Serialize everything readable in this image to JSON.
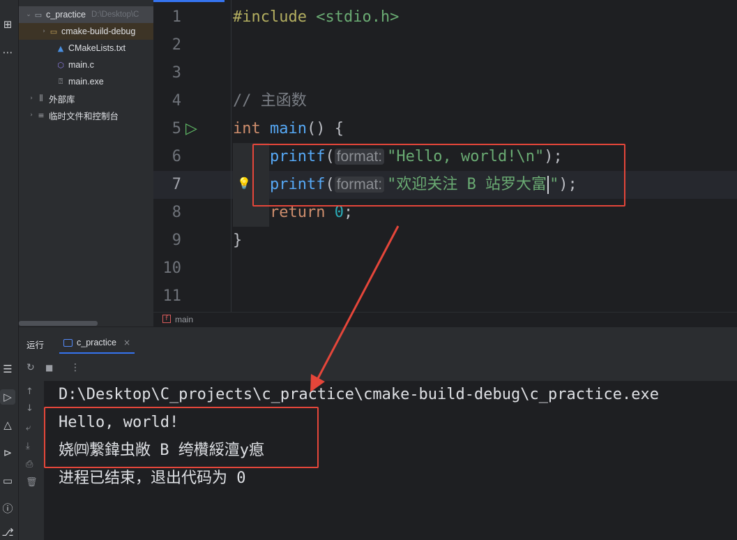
{
  "project_tree": [
    {
      "label": "c_practice",
      "hint": "D:\\Desktop\\C",
      "arrow": "⌄",
      "icon": "folder-icon",
      "depth": 1,
      "selected": true
    },
    {
      "label": "cmake-build-debug",
      "arrow": "›",
      "icon": "folder-icon",
      "depth": 2,
      "selected": false
    },
    {
      "label": "CMakeLists.txt",
      "arrow": "",
      "icon": "cmake-icon",
      "depth": 2,
      "selected": false
    },
    {
      "label": "main.c",
      "arrow": "",
      "icon": "c-file-icon",
      "depth": 2,
      "selected": false
    },
    {
      "label": "main.exe",
      "arrow": "",
      "icon": "unknown-file-icon",
      "depth": 2,
      "selected": false
    },
    {
      "label": "外部库",
      "arrow": "›",
      "icon": "library-icon",
      "depth": 1,
      "selected": false
    },
    {
      "label": "临时文件和控制台",
      "arrow": "›",
      "icon": "scratch-icon",
      "depth": 1,
      "selected": false
    }
  ],
  "editor": {
    "line_numbers": [
      "1",
      "2",
      "3",
      "4",
      "5",
      "6",
      "7",
      "8",
      "9",
      "10",
      "11"
    ],
    "current_line": "7",
    "code": {
      "l1_macro": "#include",
      "l1_header": "<stdio.h>",
      "l4_comment": "// 主函数",
      "l5_kw": "int",
      "l5_fn": "main",
      "l5_rest": "() {",
      "l6_fn": "printf",
      "l6_open": "(",
      "l6_hint": "format:",
      "l6_str": "\"Hello, world!\\n\"",
      "l6_close": ");",
      "l7_fn": "printf",
      "l7_open": "(",
      "l7_hint": "format:",
      "l7_str_a": "\"欢迎关注 B 站罗大富",
      "l7_str_b": "\"",
      "l7_close": ");",
      "l8_kw": "return",
      "l8_num": "0",
      "l8_semi": ";",
      "l9": "}"
    }
  },
  "breadcrumb": {
    "function": "main",
    "icon": "function-icon"
  },
  "run_panel": {
    "title": "运行",
    "tab_label": "c_practice",
    "console_lines": [
      "D:\\Desktop\\C_projects\\c_practice\\cmake-build-debug\\c_practice.exe",
      "Hello, world!",
      "娆㈣繋鍏虫敞 B 绔欑綏澶у瘜",
      "进程已结束，退出代码为 0"
    ]
  },
  "colors": {
    "annotation": "#e5463a",
    "accent": "#3574f0",
    "string": "#6aab73",
    "keyword": "#cf8e6d",
    "function": "#56a8f5"
  }
}
